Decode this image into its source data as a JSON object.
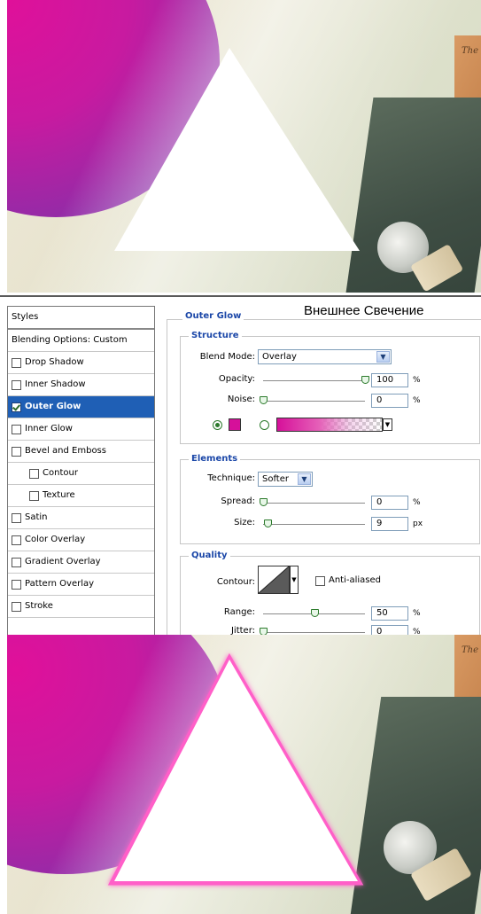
{
  "dialog": {
    "heading_ru": "Внешнее Свечение",
    "styles_header": "Styles",
    "style_items": [
      {
        "label": "Blending Options: Custom",
        "checkbox": false,
        "checked": false,
        "selected": false
      },
      {
        "label": "Drop Shadow",
        "checkbox": true,
        "checked": false,
        "selected": false
      },
      {
        "label": "Inner Shadow",
        "checkbox": true,
        "checked": false,
        "selected": false
      },
      {
        "label": "Outer Glow",
        "checkbox": true,
        "checked": true,
        "selected": true
      },
      {
        "label": "Inner Glow",
        "checkbox": true,
        "checked": false,
        "selected": false
      },
      {
        "label": "Bevel and Emboss",
        "checkbox": true,
        "checked": false,
        "selected": false
      },
      {
        "label": "Contour",
        "checkbox": true,
        "checked": false,
        "selected": false
      },
      {
        "label": "Texture",
        "checkbox": true,
        "checked": false,
        "selected": false
      },
      {
        "label": "Satin",
        "checkbox": true,
        "checked": false,
        "selected": false
      },
      {
        "label": "Color Overlay",
        "checkbox": true,
        "checked": false,
        "selected": false
      },
      {
        "label": "Gradient Overlay",
        "checkbox": true,
        "checked": false,
        "selected": false
      },
      {
        "label": "Pattern Overlay",
        "checkbox": true,
        "checked": false,
        "selected": false
      },
      {
        "label": "Stroke",
        "checkbox": true,
        "checked": false,
        "selected": false
      }
    ],
    "outer_glow": {
      "title": "Outer Glow",
      "structure": {
        "title": "Structure",
        "blend_mode_label": "Blend Mode:",
        "blend_mode_value": "Overlay",
        "opacity_label": "Opacity:",
        "opacity_value": "100",
        "opacity_unit": "%",
        "opacity_slider": 1.0,
        "noise_label": "Noise:",
        "noise_value": "0",
        "noise_unit": "%",
        "noise_slider": 0.0,
        "glow_color": "#d6109a",
        "solid_color_selected": true
      },
      "elements": {
        "title": "Elements",
        "technique_label": "Technique:",
        "technique_value": "Softer",
        "spread_label": "Spread:",
        "spread_value": "0",
        "spread_unit": "%",
        "spread_slider": 0.0,
        "size_label": "Size:",
        "size_value": "9",
        "size_unit": "px",
        "size_slider": 0.04
      },
      "quality": {
        "title": "Quality",
        "contour_label": "Contour:",
        "anti_aliased_label": "Anti-aliased",
        "anti_aliased_checked": false,
        "range_label": "Range:",
        "range_value": "50",
        "range_unit": "%",
        "range_slider": 0.5,
        "jitter_label": "Jitter:",
        "jitter_value": "0",
        "jitter_unit": "%",
        "jitter_slider": 0.0
      }
    }
  },
  "colors": {
    "selection": "#1f5fb5",
    "section_title": "#1b47a8",
    "glow_pink": "#d6109a"
  },
  "artwork_card_text": "The"
}
